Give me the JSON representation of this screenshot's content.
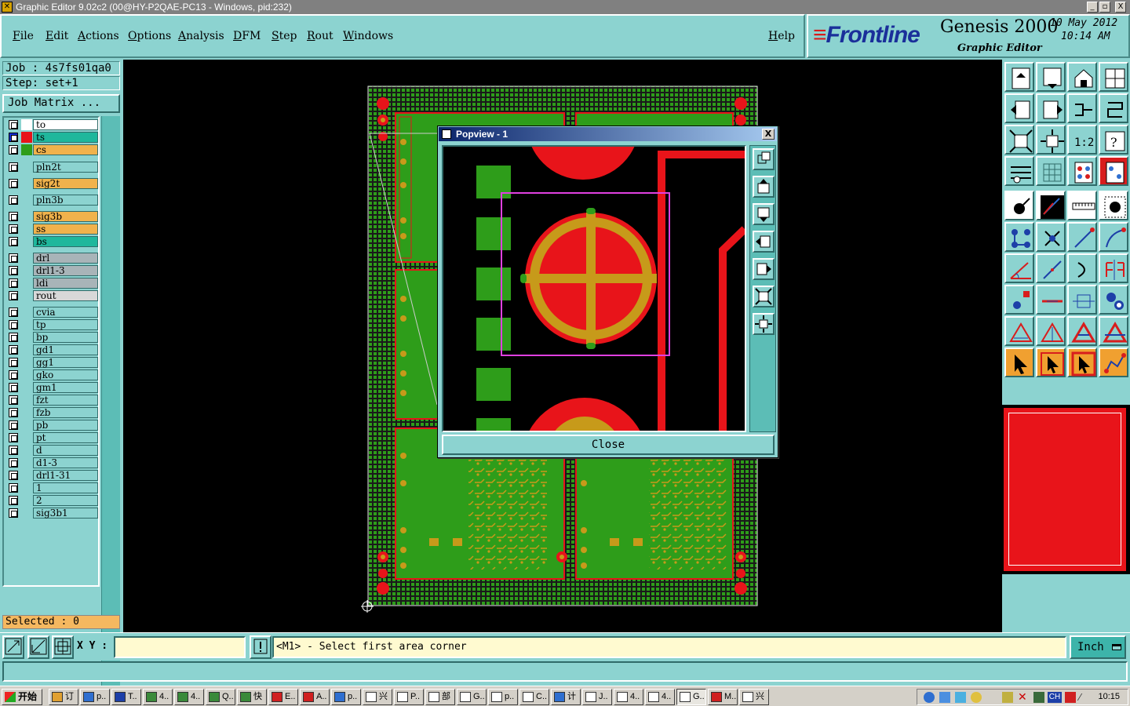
{
  "window": {
    "title": "Graphic Editor 9.02c2 (00@HY-P2QAE-PC13 - Windows, pid:232)",
    "icon": "x-app-icon",
    "minimize": "_",
    "maximize": "▫",
    "close": "X"
  },
  "menu": {
    "items": [
      "File",
      "Edit",
      "Actions",
      "Options",
      "Analysis",
      "DFM",
      "Step",
      "Rout",
      "Windows"
    ],
    "help": "Help"
  },
  "logo": {
    "brand_prefix": "≡",
    "brand": "Frontline",
    "product": "Genesis 2000",
    "subtitle": "Graphic Editor",
    "date": "10 May 2012",
    "time": "10:14 AM"
  },
  "job": {
    "job_line": "Job : 4s7fs01qa0",
    "step_line": "Step: set+1",
    "job_matrix_label": "Job Matrix ..."
  },
  "layers": [
    {
      "name": "to",
      "color": "#ffffff",
      "swatch": "#ffffff",
      "check": "#ffffff"
    },
    {
      "name": "ts",
      "color": "#1fb79c",
      "swatch": "#e8141a",
      "check": "#1430d8",
      "active": true
    },
    {
      "name": "cs",
      "color": "#f0b24c",
      "swatch": "#2e9d1a",
      "check": "#ffffff"
    },
    {
      "name": "pln2t",
      "color": "#8cd3d0",
      "swatch": "#8cd3d0",
      "check": "#ffffff"
    },
    {
      "name": "sig2t",
      "color": "#f0b24c",
      "swatch": "#8cd3d0",
      "check": "#ffffff"
    },
    {
      "name": "pln3b",
      "color": "#8cd3d0",
      "swatch": "#8cd3d0",
      "check": "#ffffff"
    },
    {
      "name": "sig3b",
      "color": "#f0b24c",
      "swatch": "#8cd3d0",
      "check": "#ffffff"
    },
    {
      "name": "ss",
      "color": "#f0b24c",
      "swatch": "#8cd3d0",
      "check": "#ffffff"
    },
    {
      "name": "bs",
      "color": "#1fb79c",
      "swatch": "#8cd3d0",
      "check": "#ffffff"
    },
    {
      "name": "drl",
      "color": "#a8b4b8",
      "swatch": "#8cd3d0",
      "check": "#ffffff"
    },
    {
      "name": "drl1-3",
      "color": "#a8b4b8",
      "swatch": "#8cd3d0",
      "check": "#ffffff"
    },
    {
      "name": "ldi",
      "color": "#a8b4b8",
      "swatch": "#8cd3d0",
      "check": "#ffffff"
    },
    {
      "name": "rout",
      "color": "#d8d8d8",
      "swatch": "#8cd3d0",
      "check": "#ffffff"
    },
    {
      "name": "cvia",
      "color": "#8cd3d0",
      "swatch": "#8cd3d0",
      "check": "#ffffff"
    },
    {
      "name": "tp",
      "color": "#8cd3d0",
      "swatch": "#8cd3d0",
      "check": "#ffffff"
    },
    {
      "name": "bp",
      "color": "#8cd3d0",
      "swatch": "#8cd3d0",
      "check": "#ffffff"
    },
    {
      "name": "gd1",
      "color": "#8cd3d0",
      "swatch": "#8cd3d0",
      "check": "#ffffff"
    },
    {
      "name": "gg1",
      "color": "#8cd3d0",
      "swatch": "#8cd3d0",
      "check": "#ffffff"
    },
    {
      "name": "gko",
      "color": "#8cd3d0",
      "swatch": "#8cd3d0",
      "check": "#ffffff"
    },
    {
      "name": "gm1",
      "color": "#8cd3d0",
      "swatch": "#8cd3d0",
      "check": "#ffffff"
    },
    {
      "name": "fzt",
      "color": "#8cd3d0",
      "swatch": "#8cd3d0",
      "check": "#ffffff"
    },
    {
      "name": "fzb",
      "color": "#8cd3d0",
      "swatch": "#8cd3d0",
      "check": "#ffffff"
    },
    {
      "name": "pb",
      "color": "#8cd3d0",
      "swatch": "#8cd3d0",
      "check": "#ffffff"
    },
    {
      "name": "pt",
      "color": "#8cd3d0",
      "swatch": "#8cd3d0",
      "check": "#ffffff"
    },
    {
      "name": "d",
      "color": "#8cd3d0",
      "swatch": "#8cd3d0",
      "check": "#ffffff"
    },
    {
      "name": "d1-3",
      "color": "#8cd3d0",
      "swatch": "#8cd3d0",
      "check": "#ffffff"
    },
    {
      "name": "drl1-31",
      "color": "#8cd3d0",
      "swatch": "#8cd3d0",
      "check": "#ffffff"
    },
    {
      "name": "1",
      "color": "#8cd3d0",
      "swatch": "#8cd3d0",
      "check": "#ffffff"
    },
    {
      "name": "2",
      "color": "#8cd3d0",
      "swatch": "#8cd3d0",
      "check": "#ffffff"
    },
    {
      "name": "sig3b1",
      "color": "#8cd3d0",
      "swatch": "#8cd3d0",
      "check": "#ffffff"
    }
  ],
  "selected_label": "Selected : 0",
  "popview": {
    "title": "Popview - 1",
    "close_label": "Close",
    "close_x": "X"
  },
  "status": {
    "xy_label": "X Y :",
    "xy_value": "",
    "message": "<M1> - Select first area corner",
    "units": "Inch",
    "command": ""
  },
  "taskbar": {
    "start_label": "开始",
    "tasks": [
      "订",
      "p..",
      "T..",
      "4..",
      "4..",
      "Q..",
      "快",
      "E..",
      "A..",
      "p..",
      "兴",
      "P..",
      "部",
      "G..",
      "p..",
      "C..",
      "计",
      "J..",
      "4..",
      "4..",
      "G..",
      "M..",
      "兴"
    ],
    "active_task_index": 20,
    "clock": "10:15",
    "ime": "CH"
  },
  "colors": {
    "panel": "#8cd3d0",
    "copper_red": "#e8141a",
    "solder_green": "#2e9d1a",
    "pad_gold": "#c79a1a",
    "select_magenta": "#e040e0"
  },
  "right_tool_icons": [
    "open-step-icon",
    "save-icon",
    "home-icon",
    "layout-icon",
    "zoom-out-icon",
    "zoom-in-icon",
    "undo-zoom-icon",
    "redo-zoom-icon",
    "fit-icon",
    "center-icon",
    "one-to-one-icon",
    "help-query-icon",
    "settings-icon",
    "grid-icon",
    "snap-icon",
    "snap-toggle-icon",
    "add-feature-icon",
    "measure-icon",
    "ruler-icon",
    "pad-icon",
    "connect-icon",
    "cross-icon",
    "line-add-icon",
    "arc-add-icon",
    "angle-icon",
    "line-icon",
    "arc-icon",
    "flip-icon",
    "move-icon",
    "minus-icon",
    "resize-icon",
    "polygon-icon",
    "surface-icon",
    "surface2-icon",
    "surface3-icon",
    "surface4-icon",
    "pointer-icon",
    "select-icon",
    "select2-icon",
    "route-icon"
  ],
  "popview_tool_icons": [
    "pop-zoom-icon",
    "pop-up-icon",
    "pop-down-icon",
    "pop-left-icon",
    "pop-right-icon",
    "pop-fit-icon",
    "pop-center-icon"
  ]
}
